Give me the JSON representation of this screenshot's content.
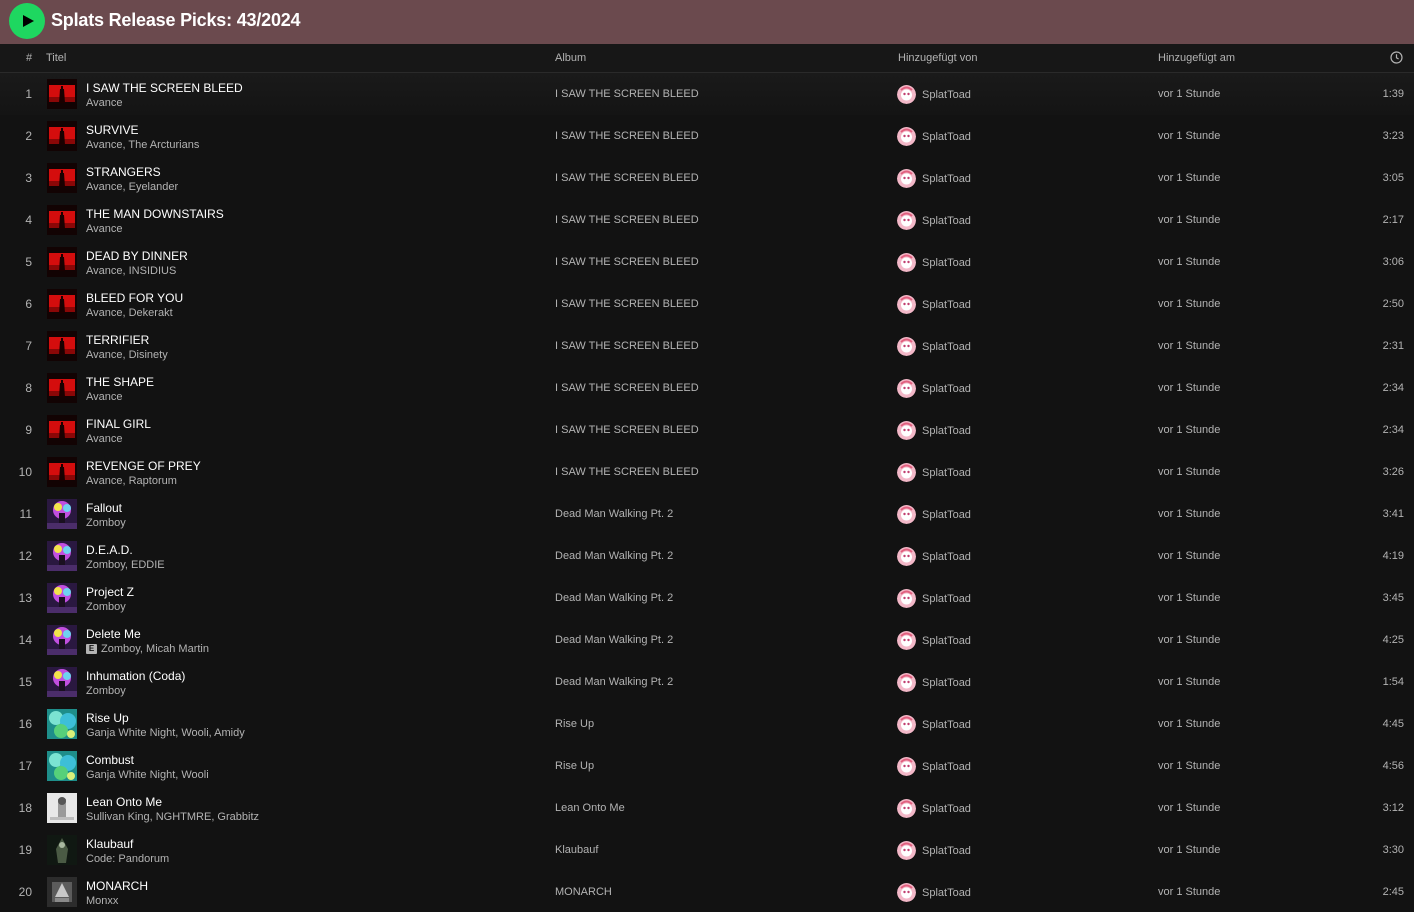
{
  "playlist": {
    "title": "Splats Release Picks: 43/2024",
    "accent": "#1ed760",
    "header_bg": "#6b4a4e"
  },
  "columns": {
    "num": "#",
    "title": "Titel",
    "album": "Album",
    "added_by": "Hinzugefügt von",
    "added_at": "Hinzugefügt am",
    "duration_icon": "clock-icon"
  },
  "tracks": [
    {
      "num": "1",
      "title": "I SAW THE SCREEN BLEED",
      "artists": "Avance",
      "album": "I SAW THE SCREEN BLEED",
      "added_by": "SplatToad",
      "added_at": "vor 1 Stunde",
      "duration": "1:39",
      "cover": "red",
      "explicit": false
    },
    {
      "num": "2",
      "title": "SURVIVE",
      "artists": "Avance, The Arcturians",
      "album": "I SAW THE SCREEN BLEED",
      "added_by": "SplatToad",
      "added_at": "vor 1 Stunde",
      "duration": "3:23",
      "cover": "red",
      "explicit": false
    },
    {
      "num": "3",
      "title": "STRANGERS",
      "artists": "Avance, Eyelander",
      "album": "I SAW THE SCREEN BLEED",
      "added_by": "SplatToad",
      "added_at": "vor 1 Stunde",
      "duration": "3:05",
      "cover": "red",
      "explicit": false
    },
    {
      "num": "4",
      "title": "THE MAN DOWNSTAIRS",
      "artists": "Avance",
      "album": "I SAW THE SCREEN BLEED",
      "added_by": "SplatToad",
      "added_at": "vor 1 Stunde",
      "duration": "2:17",
      "cover": "red",
      "explicit": false
    },
    {
      "num": "5",
      "title": "DEAD BY DINNER",
      "artists": "Avance, INSIDIUS",
      "album": "I SAW THE SCREEN BLEED",
      "added_by": "SplatToad",
      "added_at": "vor 1 Stunde",
      "duration": "3:06",
      "cover": "red",
      "explicit": false
    },
    {
      "num": "6",
      "title": "BLEED FOR YOU",
      "artists": "Avance, Dekerakt",
      "album": "I SAW THE SCREEN BLEED",
      "added_by": "SplatToad",
      "added_at": "vor 1 Stunde",
      "duration": "2:50",
      "cover": "red",
      "explicit": false
    },
    {
      "num": "7",
      "title": "TERRIFIER",
      "artists": "Avance, Disinety",
      "album": "I SAW THE SCREEN BLEED",
      "added_by": "SplatToad",
      "added_at": "vor 1 Stunde",
      "duration": "2:31",
      "cover": "red",
      "explicit": false
    },
    {
      "num": "8",
      "title": "THE SHAPE",
      "artists": "Avance",
      "album": "I SAW THE SCREEN BLEED",
      "added_by": "SplatToad",
      "added_at": "vor 1 Stunde",
      "duration": "2:34",
      "cover": "red",
      "explicit": false
    },
    {
      "num": "9",
      "title": "FINAL GIRL",
      "artists": "Avance",
      "album": "I SAW THE SCREEN BLEED",
      "added_by": "SplatToad",
      "added_at": "vor 1 Stunde",
      "duration": "2:34",
      "cover": "red",
      "explicit": false
    },
    {
      "num": "10",
      "title": "REVENGE OF PREY",
      "artists": "Avance, Raptorum",
      "album": "I SAW THE SCREEN BLEED",
      "added_by": "SplatToad",
      "added_at": "vor 1 Stunde",
      "duration": "3:26",
      "cover": "red",
      "explicit": false
    },
    {
      "num": "11",
      "title": "Fallout",
      "artists": "Zomboy",
      "album": "Dead Man Walking Pt. 2",
      "added_by": "SplatToad",
      "added_at": "vor 1 Stunde",
      "duration": "3:41",
      "cover": "purple",
      "explicit": false
    },
    {
      "num": "12",
      "title": "D.E.A.D.",
      "artists": "Zomboy, EDDIE",
      "album": "Dead Man Walking Pt. 2",
      "added_by": "SplatToad",
      "added_at": "vor 1 Stunde",
      "duration": "4:19",
      "cover": "purple",
      "explicit": false
    },
    {
      "num": "13",
      "title": "Project Z",
      "artists": "Zomboy",
      "album": "Dead Man Walking Pt. 2",
      "added_by": "SplatToad",
      "added_at": "vor 1 Stunde",
      "duration": "3:45",
      "cover": "purple",
      "explicit": false
    },
    {
      "num": "14",
      "title": "Delete Me",
      "artists": "Zomboy, Micah Martin",
      "album": "Dead Man Walking Pt. 2",
      "added_by": "SplatToad",
      "added_at": "vor 1 Stunde",
      "duration": "4:25",
      "cover": "purple",
      "explicit": true,
      "explicit_label": "E"
    },
    {
      "num": "15",
      "title": "Inhumation (Coda)",
      "artists": "Zomboy",
      "album": "Dead Man Walking Pt. 2",
      "added_by": "SplatToad",
      "added_at": "vor 1 Stunde",
      "duration": "1:54",
      "cover": "purple",
      "explicit": false
    },
    {
      "num": "16",
      "title": "Rise Up",
      "artists": "Ganja White Night, Wooli, Amidy",
      "album": "Rise Up",
      "added_by": "SplatToad",
      "added_at": "vor 1 Stunde",
      "duration": "4:45",
      "cover": "teal",
      "explicit": false
    },
    {
      "num": "17",
      "title": "Combust",
      "artists": "Ganja White Night, Wooli",
      "album": "Rise Up",
      "added_by": "SplatToad",
      "added_at": "vor 1 Stunde",
      "duration": "4:56",
      "cover": "teal",
      "explicit": false
    },
    {
      "num": "18",
      "title": "Lean Onto Me",
      "artists": "Sullivan King, NGHTMRE, Grabbitz",
      "album": "Lean Onto Me",
      "added_by": "SplatToad",
      "added_at": "vor 1 Stunde",
      "duration": "3:12",
      "cover": "white",
      "explicit": false
    },
    {
      "num": "19",
      "title": "Klaubauf",
      "artists": "Code: Pandorum",
      "album": "Klaubauf",
      "added_by": "SplatToad",
      "added_at": "vor 1 Stunde",
      "duration": "3:30",
      "cover": "dark",
      "explicit": false
    },
    {
      "num": "20",
      "title": "MONARCH",
      "artists": "Monxx",
      "album": "MONARCH",
      "added_by": "SplatToad",
      "added_at": "vor 1 Stunde",
      "duration": "2:45",
      "cover": "grey",
      "explicit": false
    }
  ]
}
